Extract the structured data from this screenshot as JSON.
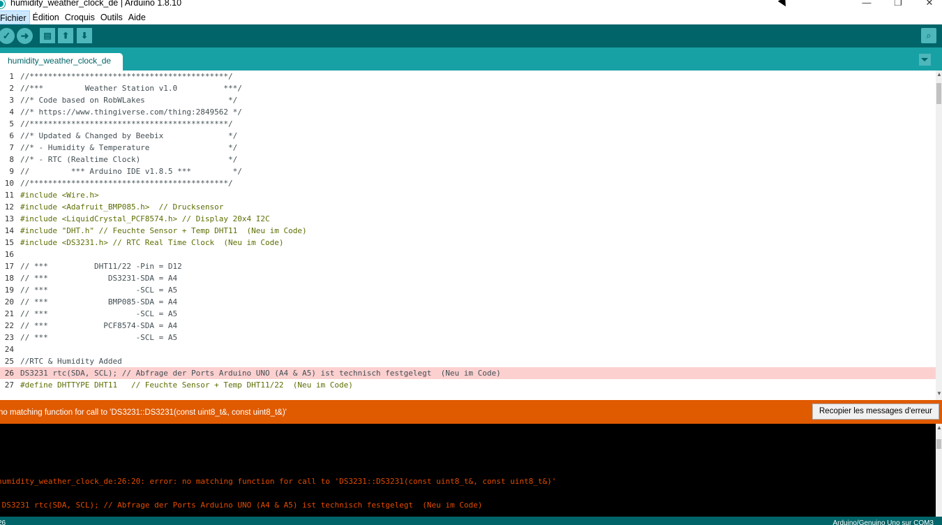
{
  "window": {
    "title": "humidity_weather_clock_de | Arduino 1.8.10",
    "minimize": "—",
    "maximize": "❐",
    "close": "✕"
  },
  "menu": {
    "items": [
      "Fichier",
      "Édition",
      "Croquis",
      "Outils",
      "Aide"
    ]
  },
  "toolbar": {
    "verify_icon": "✓",
    "upload_icon": "➜",
    "new_icon": "▤",
    "open_icon": "⬆",
    "save_icon": "⬇",
    "serial_icon": "⌕"
  },
  "tabs": {
    "active": "humidity_weather_clock_de"
  },
  "editor": {
    "lines": [
      {
        "n": "1",
        "text": "//*******************************************/"
      },
      {
        "n": "2",
        "text": "//***         Weather Station v1.0          ***/"
      },
      {
        "n": "3",
        "text": "//* Code based on RobWLakes                  */"
      },
      {
        "n": "4",
        "text": "//* https://www.thingiverse.com/thing:2849562 */"
      },
      {
        "n": "5",
        "text": "//*******************************************/"
      },
      {
        "n": "6",
        "text": "//* Updated & Changed by Beebix              */"
      },
      {
        "n": "7",
        "text": "//* - Humidity & Temperature                 */"
      },
      {
        "n": "8",
        "text": "//* - RTC (Realtime Clock)                   */"
      },
      {
        "n": "9",
        "text": "//         *** Arduino IDE v1.8.5 ***         */"
      },
      {
        "n": "10",
        "text": "//*******************************************/"
      },
      {
        "n": "11",
        "text": "#include <Wire.h>"
      },
      {
        "n": "12",
        "text": "#include <Adafruit_BMP085.h>  // Drucksensor"
      },
      {
        "n": "13",
        "text": "#include <LiquidCrystal_PCF8574.h> // Display 20x4 I2C"
      },
      {
        "n": "14",
        "text": "#include \"DHT.h\" // Feuchte Sensor + Temp DHT11  (Neu im Code)"
      },
      {
        "n": "15",
        "text": "#include <DS3231.h> // RTC Real Time Clock  (Neu im Code)"
      },
      {
        "n": "16",
        "text": ""
      },
      {
        "n": "17",
        "text": "// ***          DHT11/22 -Pin = D12"
      },
      {
        "n": "18",
        "text": "// ***             DS3231-SDA = A4"
      },
      {
        "n": "19",
        "text": "// ***                   -SCL = A5"
      },
      {
        "n": "20",
        "text": "// ***             BMP085-SDA = A4"
      },
      {
        "n": "21",
        "text": "// ***                   -SCL = A5"
      },
      {
        "n": "22",
        "text": "// ***            PCF8574-SDA = A4"
      },
      {
        "n": "23",
        "text": "// ***                   -SCL = A5"
      },
      {
        "n": "24",
        "text": ""
      },
      {
        "n": "25",
        "text": "//RTC & Humidity Added"
      },
      {
        "n": "26",
        "text": "DS3231 rtc(SDA, SCL); // Abfrage der Ports Arduino UNO (A4 & A5) ist technisch festgelegt  (Neu im Code)"
      },
      {
        "n": "27",
        "text": "#define DHTTYPE DHT11   // Feuchte Sensor + Temp DHT11/22  (Neu im Code)"
      }
    ],
    "error_line": "26"
  },
  "status": {
    "message": "no matching function for call to 'DS3231::DS3231(const uint8_t&, const uint8_t&)'",
    "copy_button": "Recopier les messages d'erreur"
  },
  "console": {
    "lines": [
      "humidity_weather_clock_de:26:20: error: no matching function for call to 'DS3231::DS3231(const uint8_t&, const uint8_t&)'",
      " DS3231 rtc(SDA, SCL); // Abfrage der Ports Arduino UNO (A4 & A5) ist technisch festgelegt  (Neu im Code)"
    ]
  },
  "bottom": {
    "line_number": "26",
    "board": "Arduino/Genuino Uno sur COM3"
  },
  "colors": {
    "toolbar": "#006468",
    "tabbar": "#17a1a5",
    "error_bar": "#e05a00",
    "error_line_bg": "#fdd0d0",
    "console_text": "#e34c00"
  }
}
